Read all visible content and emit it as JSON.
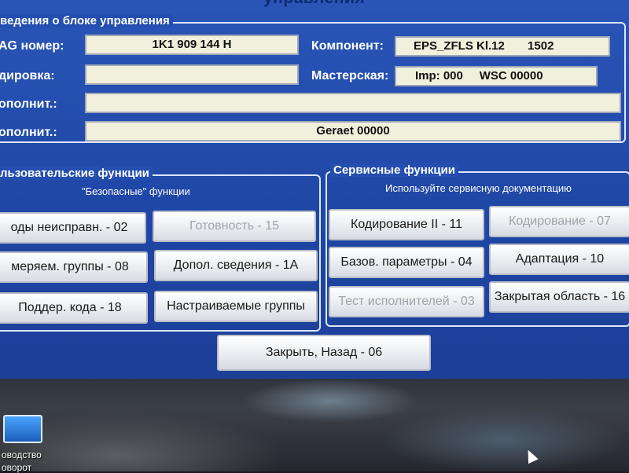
{
  "window": {
    "title": "управления"
  },
  "info_group": {
    "title": "ведения о блоке управления",
    "rows": {
      "vag_label": "AG номер:",
      "vag_value": "1K1 909 144 H",
      "component_label": "Компонент:",
      "component_value": "EPS_ZFLS Kl.12       1502",
      "coding_label": "дировка:",
      "coding_value": "",
      "shop_label": "Мастерская:",
      "shop_value": "Imp: 000     WSC 00000",
      "extra1_label": "ополнит.:",
      "extra1_value": "",
      "extra2_label": "ополнит.:",
      "extra2_value": "Geraet 00000"
    }
  },
  "user_functions": {
    "title": "льзовательские функции",
    "subtitle": "\"Безопасные\" функции",
    "buttons": {
      "fault_codes": "оды неисправн. - 02",
      "readiness": "Готовность - 15",
      "measuring_blocks": "меряем. группы - 08",
      "advanced_id": "Допол. сведения - 1A",
      "supported_codes": "Поддер. кода - 18",
      "adv_meas_values": "Настраиваемые группы"
    }
  },
  "service_functions": {
    "title": "Сервисные функции",
    "subtitle": "Используйте сервисную документацию",
    "buttons": {
      "coding2": "Кодирование II - 11",
      "coding": "Кодирование - 07",
      "basic_settings": "Базов. параметры - 04",
      "adaptation": "Адаптация - 10",
      "output_tests": "Тест исполнителей - 03",
      "security_access": "Закрытая область - 16"
    }
  },
  "footer": {
    "close_back": "Закрыть, Назад - 06"
  },
  "desktop": {
    "label_line1": "оводство",
    "label_line2": "оворот"
  }
}
